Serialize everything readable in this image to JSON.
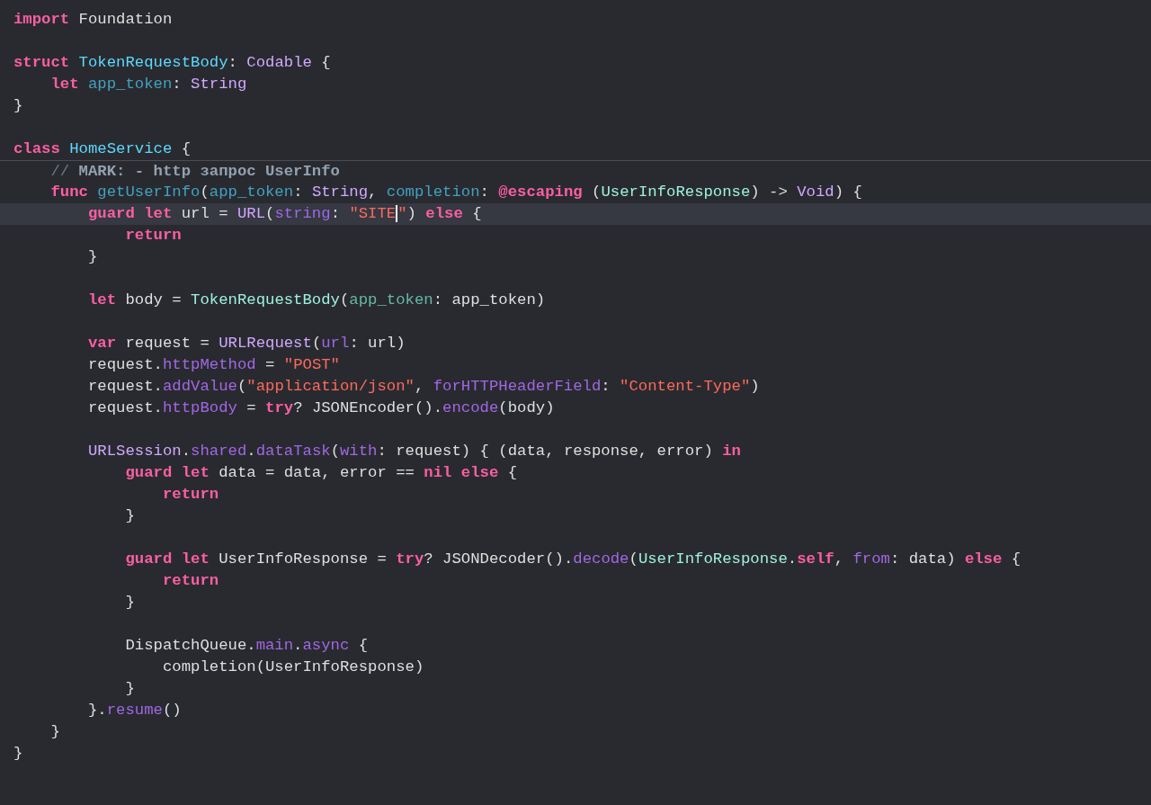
{
  "editor": {
    "lines": [
      {
        "current": false,
        "tokens": [
          {
            "text": "import",
            "kind": "keyword"
          },
          {
            "text": " Foundation",
            "kind": "plain"
          }
        ]
      },
      {
        "current": false
      },
      {
        "current": false,
        "tokens": [
          {
            "text": "struct",
            "kind": "keyword"
          },
          {
            "text": " TokenRequestBody",
            "kind": "decl_type"
          },
          {
            "text": ": ",
            "kind": "plain"
          },
          {
            "text": "Codable",
            "kind": "sys_type"
          },
          {
            "text": " {",
            "kind": "plain"
          }
        ],
        "children": [
          {
            "current": false,
            "tokens": [
              {
                "text": "let",
                "kind": "keyword"
              },
              {
                "text": " app_token",
                "kind": "decl"
              },
              {
                "text": ": ",
                "kind": "plain"
              },
              {
                "text": "String",
                "kind": "sys_type"
              }
            ]
          }
        ]
      },
      {
        "current": false,
        "tokens": [
          {
            "text": "}",
            "kind": "plain"
          }
        ]
      },
      {
        "current": false
      },
      {
        "current": false,
        "tokens": [
          {
            "text": "class",
            "kind": "keyword"
          },
          {
            "text": " HomeService",
            "kind": "decl_type"
          },
          {
            "text": " {",
            "kind": "plain"
          }
        ],
        "children": [
          {
            "current": false,
            "divider_above": true,
            "tokens": [
              {
                "text": "// ",
                "kind": "comment"
              },
              {
                "text": "MARK: - http запрос UserInfo",
                "kind": "mark"
              }
            ]
          },
          {
            "current": false,
            "tokens": [
              {
                "text": "func",
                "kind": "keyword"
              },
              {
                "text": " getUserInfo",
                "kind": "decl"
              },
              {
                "text": "(",
                "kind": "plain"
              },
              {
                "text": "app_token",
                "kind": "decl"
              },
              {
                "text": ": ",
                "kind": "plain"
              },
              {
                "text": "String",
                "kind": "sys_type"
              },
              {
                "text": ", ",
                "kind": "plain"
              },
              {
                "text": "completion",
                "kind": "decl"
              },
              {
                "text": ": ",
                "kind": "plain"
              },
              {
                "text": "@escaping",
                "kind": "keyword"
              },
              {
                "text": " (",
                "kind": "plain"
              },
              {
                "text": "UserInfoResponse",
                "kind": "project_type"
              },
              {
                "text": ") -> ",
                "kind": "plain"
              },
              {
                "text": "Void",
                "kind": "sys_type"
              },
              {
                "text": ") {",
                "kind": "plain"
              }
            ],
            "children": [
              {
                "current": true,
                "tokens": [
                  {
                    "text": "guard let",
                    "kind": "keyword"
                  },
                  {
                    "text": " url = ",
                    "kind": "plain"
                  },
                  {
                    "text": "URL",
                    "kind": "sys_type"
                  },
                  {
                    "text": "(",
                    "kind": "plain"
                  },
                  {
                    "text": "string",
                    "kind": "sys_member"
                  },
                  {
                    "text": ": ",
                    "kind": "plain"
                  },
                  {
                    "text": "\"SITE",
                    "kind": "string",
                    "cursor_after": true
                  },
                  {
                    "text": "\"",
                    "kind": "string"
                  },
                  {
                    "text": ") ",
                    "kind": "plain"
                  },
                  {
                    "text": "else",
                    "kind": "keyword"
                  },
                  {
                    "text": " {",
                    "kind": "plain"
                  }
                ],
                "children": [
                  {
                    "current": false,
                    "tokens": [
                      {
                        "text": "return",
                        "kind": "keyword"
                      }
                    ]
                  }
                ]
              },
              {
                "current": false,
                "tokens": [
                  {
                    "text": "}",
                    "kind": "plain"
                  }
                ]
              },
              {
                "current": false
              },
              {
                "current": false,
                "tokens": [
                  {
                    "text": "let",
                    "kind": "keyword"
                  },
                  {
                    "text": " body = ",
                    "kind": "plain"
                  },
                  {
                    "text": "TokenRequestBody",
                    "kind": "project_type"
                  },
                  {
                    "text": "(",
                    "kind": "plain"
                  },
                  {
                    "text": "app_token",
                    "kind": "project_member"
                  },
                  {
                    "text": ": app_token)",
                    "kind": "plain"
                  }
                ]
              },
              {
                "current": false
              },
              {
                "current": false,
                "tokens": [
                  {
                    "text": "var",
                    "kind": "keyword"
                  },
                  {
                    "text": " request = ",
                    "kind": "plain"
                  },
                  {
                    "text": "URLRequest",
                    "kind": "sys_type"
                  },
                  {
                    "text": "(",
                    "kind": "plain"
                  },
                  {
                    "text": "url",
                    "kind": "sys_member"
                  },
                  {
                    "text": ": url)",
                    "kind": "plain"
                  }
                ]
              },
              {
                "current": false,
                "tokens": [
                  {
                    "text": "request.",
                    "kind": "plain"
                  },
                  {
                    "text": "httpMethod",
                    "kind": "sys_member"
                  },
                  {
                    "text": " = ",
                    "kind": "plain"
                  },
                  {
                    "text": "\"POST\"",
                    "kind": "string"
                  }
                ]
              },
              {
                "current": false,
                "tokens": [
                  {
                    "text": "request.",
                    "kind": "plain"
                  },
                  {
                    "text": "addValue",
                    "kind": "sys_member"
                  },
                  {
                    "text": "(",
                    "kind": "plain"
                  },
                  {
                    "text": "\"application/json\"",
                    "kind": "string"
                  },
                  {
                    "text": ", ",
                    "kind": "plain"
                  },
                  {
                    "text": "forHTTPHeaderField",
                    "kind": "sys_member"
                  },
                  {
                    "text": ": ",
                    "kind": "plain"
                  },
                  {
                    "text": "\"Content-Type\"",
                    "kind": "string"
                  },
                  {
                    "text": ")",
                    "kind": "plain"
                  }
                ]
              },
              {
                "current": false,
                "tokens": [
                  {
                    "text": "request.",
                    "kind": "plain"
                  },
                  {
                    "text": "httpBody",
                    "kind": "sys_member"
                  },
                  {
                    "text": " = ",
                    "kind": "plain"
                  },
                  {
                    "text": "try",
                    "kind": "keyword"
                  },
                  {
                    "text": "? JSONEncoder().",
                    "kind": "plain"
                  },
                  {
                    "text": "encode",
                    "kind": "sys_member"
                  },
                  {
                    "text": "(body)",
                    "kind": "plain"
                  }
                ]
              },
              {
                "current": false
              },
              {
                "current": false,
                "tokens": [
                  {
                    "text": "URLSession",
                    "kind": "sys_type"
                  },
                  {
                    "text": ".",
                    "kind": "plain"
                  },
                  {
                    "text": "shared",
                    "kind": "sys_member"
                  },
                  {
                    "text": ".",
                    "kind": "plain"
                  },
                  {
                    "text": "dataTask",
                    "kind": "sys_member"
                  },
                  {
                    "text": "(",
                    "kind": "plain"
                  },
                  {
                    "text": "with",
                    "kind": "sys_member"
                  },
                  {
                    "text": ": request) { (data, response, error) ",
                    "kind": "plain"
                  },
                  {
                    "text": "in",
                    "kind": "keyword"
                  }
                ],
                "children": [
                  {
                    "current": false,
                    "tokens": [
                      {
                        "text": "guard let",
                        "kind": "keyword"
                      },
                      {
                        "text": " data = data, error == ",
                        "kind": "plain"
                      },
                      {
                        "text": "nil",
                        "kind": "keyword"
                      },
                      {
                        "text": " else",
                        "kind": "keyword"
                      },
                      {
                        "text": " {",
                        "kind": "plain"
                      }
                    ],
                    "children": [
                      {
                        "current": false,
                        "tokens": [
                          {
                            "text": "return",
                            "kind": "keyword"
                          }
                        ]
                      }
                    ]
                  },
                  {
                    "current": false,
                    "tokens": [
                      {
                        "text": "}",
                        "kind": "plain"
                      }
                    ]
                  },
                  {
                    "current": false
                  },
                  {
                    "current": false,
                    "tokens": [
                      {
                        "text": "guard let",
                        "kind": "keyword"
                      },
                      {
                        "text": " UserInfoResponse = ",
                        "kind": "plain"
                      },
                      {
                        "text": "try",
                        "kind": "keyword"
                      },
                      {
                        "text": "? JSONDecoder().",
                        "kind": "plain"
                      },
                      {
                        "text": "decode",
                        "kind": "sys_member"
                      },
                      {
                        "text": "(",
                        "kind": "plain"
                      },
                      {
                        "text": "UserInfoResponse",
                        "kind": "project_type"
                      },
                      {
                        "text": ".",
                        "kind": "plain"
                      },
                      {
                        "text": "self",
                        "kind": "keyword"
                      },
                      {
                        "text": ", ",
                        "kind": "plain"
                      },
                      {
                        "text": "from",
                        "kind": "sys_member"
                      },
                      {
                        "text": ": data) ",
                        "kind": "plain"
                      },
                      {
                        "text": "else",
                        "kind": "keyword"
                      },
                      {
                        "text": " {",
                        "kind": "plain"
                      }
                    ],
                    "children": [
                      {
                        "current": false,
                        "tokens": [
                          {
                            "text": "return",
                            "kind": "keyword"
                          }
                        ]
                      }
                    ]
                  },
                  {
                    "current": false,
                    "tokens": [
                      {
                        "text": "}",
                        "kind": "plain"
                      }
                    ]
                  },
                  {
                    "current": false
                  },
                  {
                    "current": false,
                    "tokens": [
                      {
                        "text": "DispatchQueue.",
                        "kind": "plain"
                      },
                      {
                        "text": "main",
                        "kind": "sys_member"
                      },
                      {
                        "text": ".",
                        "kind": "plain"
                      },
                      {
                        "text": "async",
                        "kind": "sys_member"
                      },
                      {
                        "text": " {",
                        "kind": "plain"
                      }
                    ],
                    "children": [
                      {
                        "current": false,
                        "tokens": [
                          {
                            "text": "completion(UserInfoResponse)",
                            "kind": "plain"
                          }
                        ]
                      }
                    ]
                  },
                  {
                    "current": false,
                    "tokens": [
                      {
                        "text": "}",
                        "kind": "plain"
                      }
                    ]
                  }
                ]
              },
              {
                "current": false,
                "tokens": [
                  {
                    "text": "}.",
                    "kind": "plain"
                  },
                  {
                    "text": "resume",
                    "kind": "sys_member"
                  },
                  {
                    "text": "()",
                    "kind": "plain"
                  }
                ]
              }
            ]
          },
          {
            "current": false,
            "tokens": [
              {
                "text": "}",
                "kind": "plain"
              }
            ]
          }
        ]
      },
      {
        "current": false,
        "tokens": [
          {
            "text": "}",
            "kind": "plain"
          }
        ]
      }
    ]
  }
}
